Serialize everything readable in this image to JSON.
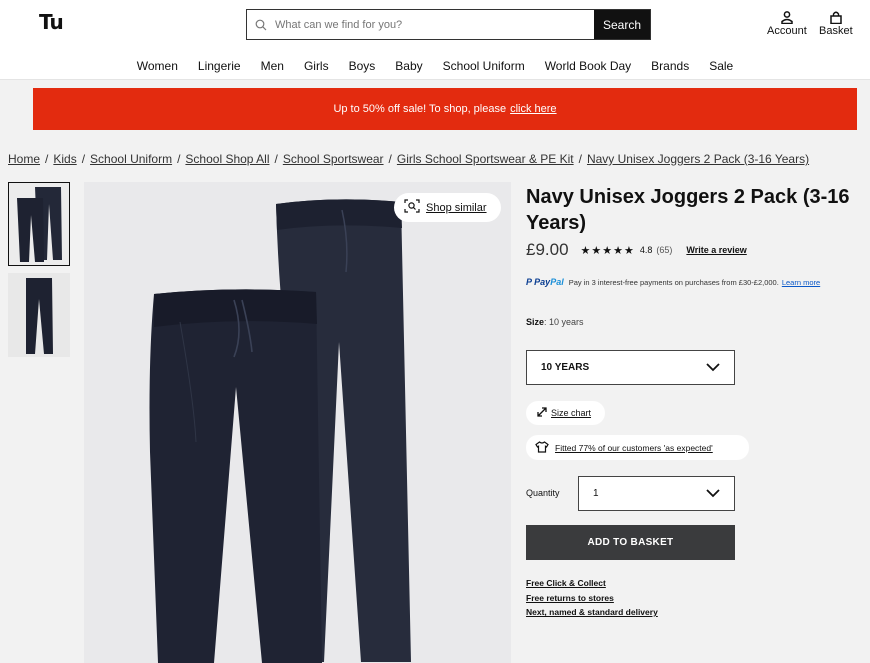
{
  "header": {
    "logo": "Tu",
    "search_placeholder": "What can we find for you?",
    "search_button": "Search",
    "account_label": "Account",
    "basket_label": "Basket"
  },
  "nav": [
    "Women",
    "Lingerie",
    "Men",
    "Girls",
    "Boys",
    "Baby",
    "School Uniform",
    "World Book Day",
    "Brands",
    "Sale"
  ],
  "banner": {
    "text": "Up to 50% off sale! To shop, please",
    "link": "click here"
  },
  "breadcrumbs": [
    "Home",
    "Kids",
    "School Uniform",
    "School Shop All",
    "School Sportswear",
    "Girls School Sportswear & PE Kit",
    "Navy Unisex Joggers 2 Pack (3-16 Years)"
  ],
  "gallery": {
    "shop_similar": "Shop similar"
  },
  "product": {
    "title": "Navy Unisex Joggers 2 Pack (3-16 Years)",
    "price": "£9.00",
    "stars": "★★★★★",
    "rating": "4.8",
    "review_count": "(65)",
    "write_review": "Write a review",
    "paypal_brand_a": "Pay",
    "paypal_brand_b": "Pal",
    "paypal_text": "Pay in 3 interest-free payments on purchases from £30-£2,000.",
    "paypal_learn_more": "Learn more",
    "size_label": "Size",
    "size_value": ": 10 years",
    "size_selected": "10 YEARS",
    "size_chart": "Size chart",
    "fit_text": "Fitted 77% of our customers 'as expected'",
    "quantity_label": "Quantity",
    "quantity_value": "1",
    "add_to_basket": "ADD TO BASKET",
    "delivery_links": [
      "Free Click & Collect",
      "Free returns to stores",
      "Next, named & standard delivery"
    ]
  },
  "colors": {
    "banner": "#e32b0f",
    "button": "#3a3b3d",
    "joggers": "#232838"
  }
}
